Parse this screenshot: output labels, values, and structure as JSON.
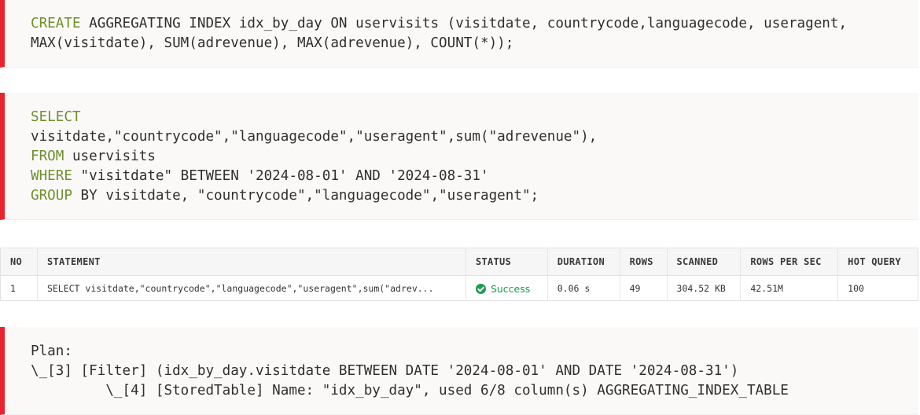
{
  "create_block": {
    "line1_kw": "CREATE",
    "line1_rest": " AGGREGATING INDEX idx_by_day ON uservisits (visitdate, countrycode,languagecode, useragent,",
    "line2": "MAX(visitdate), SUM(adrevenue), MAX(adrevenue), COUNT(*));"
  },
  "select_block": {
    "l1_kw": "SELECT",
    "l2": "visitdate,\"countrycode\",\"languagecode\",\"useragent\",sum(\"adrevenue\"),",
    "l3_kw": "FROM",
    "l3_rest": " uservisits",
    "l4_kw": "WHERE",
    "l4_rest": " \"visitdate\" BETWEEN '2024-08-01' AND '2024-08-31'",
    "l5_kw": "GROUP",
    "l5_rest": " BY visitdate, \"countrycode\",\"languagecode\",\"useragent\";"
  },
  "result_table": {
    "headers": [
      "NO",
      "STATEMENT",
      "STATUS",
      "DURATION",
      "ROWS",
      "SCANNED",
      "ROWS PER SEC",
      "HOT QUERY"
    ],
    "row": {
      "no": "1",
      "statement": "SELECT visitdate,\"countrycode\",\"languagecode\",\"useragent\",sum(\"adrev...",
      "status": "Success",
      "duration": "0.06 s",
      "rows": "49",
      "scanned": "304.52 KB",
      "rows_per_sec": "42.51M",
      "hot_query": "100"
    },
    "status_color": "#1f9a52"
  },
  "plan_block": {
    "l1": "Plan:",
    "l2": "\\_[3] [Filter] (idx_by_day.visitdate BETWEEN DATE '2024-08-01' AND DATE '2024-08-31')",
    "l3": "         \\_[4] [StoredTable] Name: \"idx_by_day\", used 6/8 column(s) AGGREGATING_INDEX_TABLE"
  },
  "colors": {
    "accent_bar": "#e8232e",
    "keyword": "#6f8f2b",
    "block_bg": "#fbf9f8"
  }
}
